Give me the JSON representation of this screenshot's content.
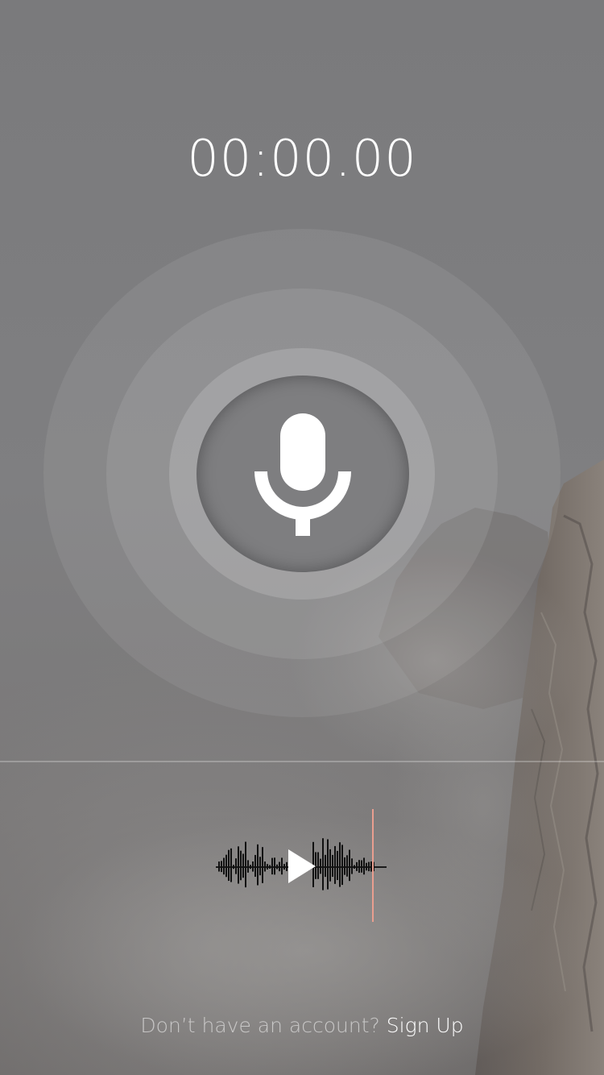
{
  "timer": {
    "value": "00:00.00"
  },
  "record": {
    "icon": "microphone-icon"
  },
  "player": {
    "play_icon": "play-icon",
    "waveform_icon": "waveform-icon",
    "playhead_color": "#e0755f"
  },
  "footer": {
    "prompt": "Don’t have an account?",
    "link": "Sign Up"
  },
  "colors": {
    "background": "#7d7d7f",
    "text": "#ffffff",
    "button_fill": "#7e7e80"
  }
}
